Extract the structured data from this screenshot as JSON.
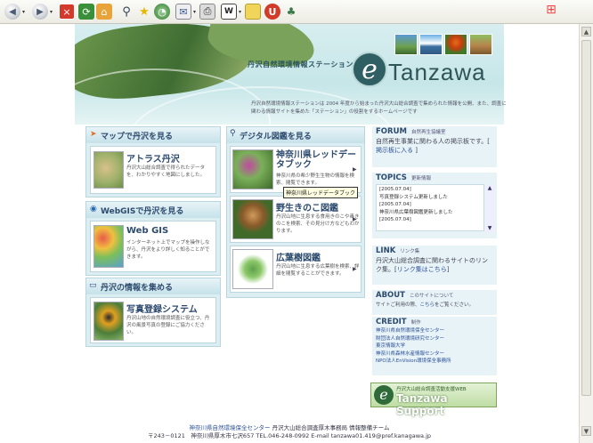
{
  "browser": {
    "toolbar_icons": [
      "back-icon",
      "forward-icon",
      "stop-icon",
      "refresh-icon",
      "home-icon",
      "search-icon",
      "favorites-icon",
      "history-icon",
      "mail-icon",
      "print-icon",
      "edit-icon",
      "discuss-icon",
      "messenger-icon",
      "toolbar-icon-msn"
    ]
  },
  "header": {
    "station_label": "丹沢自然環境情報ステーション",
    "logo_letter": "e",
    "logo_text": "Tanzawa",
    "intro": "丹沢自然環境情報ステーションは 2004 年度から始まった丹沢大山総合調査で集められた情報を公開、また、調査に関わる情報サイトを集めた「ステーション」の役割をするホームページです"
  },
  "left": {
    "map": {
      "heading": "マップで丹沢を見る",
      "title": "アトラス丹沢",
      "desc": "丹沢大山総合調査で得られたデータを、わかりやすく地図にしました。"
    },
    "webgis": {
      "heading": "WebGISで丹沢を見る",
      "title": "Web GIS",
      "desc": "インターネット上でマップを操作しながら、丹沢をより詳しく知ることができます。"
    },
    "info": {
      "heading": "丹沢の情報を集める",
      "title": "写真登録システム",
      "desc": "丹沢山地の自然環境調査に役立つ、丹沢の風景写真の登録にご協力ください。"
    }
  },
  "middle": {
    "heading": "デジタル図鑑を見る",
    "items": [
      {
        "title": "神奈川県レッドデータブック",
        "desc": "神奈川県の希少野生生物の情報を検索、閲覧できます。"
      },
      {
        "title": "野生きのこ図鑑",
        "desc": "丹沢山地に生息する食用きのこや毒きのこを検索、その見分け方などもわかります。"
      },
      {
        "title": "広葉樹図鑑",
        "desc": "丹沢山地に生息する広葉樹を検索、詳細を閲覧することができます。"
      }
    ],
    "tooltip": "神奈川県レッドデータブック"
  },
  "right": {
    "forum": {
      "heading": "FORUM",
      "sub": "自然再生協議室",
      "text": "自然再生事業に関わる人の掲示板です。[",
      "link": "掲示板に入る",
      "tail": "]"
    },
    "topics": {
      "heading": "TOPICS",
      "sub": "更新情報",
      "lines": [
        "[2005.07.04]",
        "写真登録システム更新しました",
        "[2005.07.04]",
        "神奈川県広葉樹図鑑更新しました",
        "[2005.07.04]"
      ]
    },
    "link": {
      "heading": "LINK",
      "sub": "リンク集",
      "text": "丹沢大山総合調査に関わるサイトのリンク集。[",
      "link": "リンク集はこちら",
      "tail": "]"
    },
    "about": {
      "heading": "ABOUT",
      "sub": "このサイトについて",
      "text": "サイトご利用の際、",
      "link": "こちら",
      "tail": "をご覧ください。"
    },
    "credit": {
      "heading": "CREDIT",
      "sub": "制作",
      "items": [
        "神奈川県自然環境保全センター",
        "財団法人自然環境研究センター",
        "東京情報大学",
        "神奈川県森林水産情報センター",
        "NPO法人EnVision環境保全事務所"
      ]
    },
    "support": {
      "small": "丹沢大山総合調査活動支援WEB",
      "big": "Tanzawa Support",
      "letter": "e"
    }
  },
  "footer": {
    "line1_link": "神奈川県自然環境保全センター",
    "line1_text": "丹沢大山総合調査厚木事務局 情報整備チーム",
    "line2": "〒243－0121　神奈川県厚木市七沢657  TEL.046-248-0992  E-mail tanzawa01.419@pref.kanagawa.jp"
  },
  "colors": {
    "accent": "#2d4b6e",
    "panel": "#dceef2",
    "logo": "#2f5f63"
  }
}
